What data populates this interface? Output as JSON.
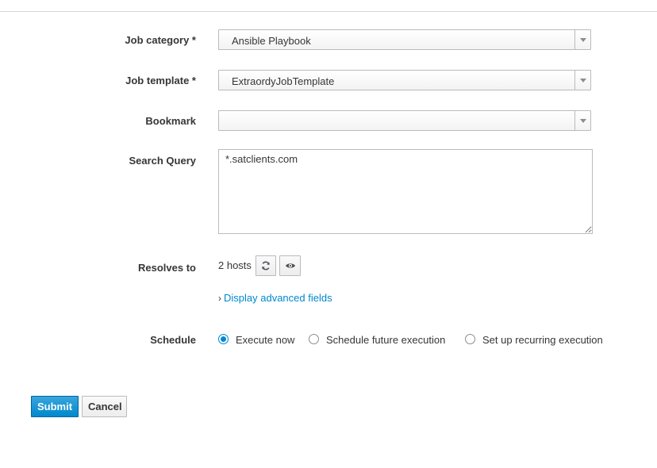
{
  "form": {
    "job_category": {
      "label": "Job category *",
      "value": "Ansible Playbook"
    },
    "job_template": {
      "label": "Job template *",
      "value": "ExtraordyJobTemplate"
    },
    "bookmark": {
      "label": "Bookmark",
      "value": ""
    },
    "search_query": {
      "label": "Search Query",
      "value": "*.satclients.com"
    },
    "resolves_to": {
      "label": "Resolves to",
      "hosts": "2 hosts",
      "refresh_icon": "refresh-icon",
      "preview_icon": "eye-icon"
    },
    "advanced_link": "Display advanced fields",
    "schedule": {
      "label": "Schedule",
      "options": [
        {
          "label": "Execute now",
          "checked": true
        },
        {
          "label": "Schedule future execution",
          "checked": false
        },
        {
          "label": "Set up recurring execution",
          "checked": false
        }
      ]
    }
  },
  "actions": {
    "submit_label": "Submit",
    "cancel_label": "Cancel"
  },
  "colors": {
    "accent": "#0088ce",
    "primary_button": "#0088ce",
    "text": "#363636",
    "border": "#bbbbbb"
  }
}
